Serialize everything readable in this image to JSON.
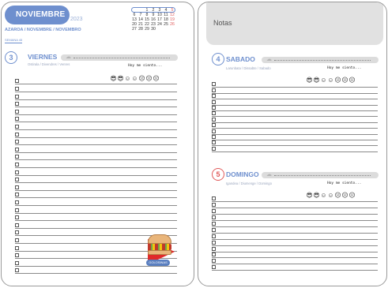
{
  "left": {
    "month": "NOVIEMBRE",
    "year": "2023",
    "subtitle": "AZAROA / NOVEMBRE / NOVEMBRO",
    "week": "SEMANA 45",
    "mini_calendar": [
      [
        "",
        "1",
        "2",
        "3",
        "4",
        "5"
      ],
      [
        "6",
        "7",
        "8",
        "9",
        "10",
        "11",
        "12"
      ],
      [
        "13",
        "14",
        "15",
        "16",
        "17",
        "18",
        "19"
      ],
      [
        "20",
        "21",
        "22",
        "23",
        "24",
        "25",
        "26"
      ],
      [
        "27",
        "28",
        "29",
        "30"
      ]
    ],
    "day": {
      "number": "3",
      "name": "VIERNES",
      "sub": "Ostirala / Divendres / Venres",
      "mood_label": "Hoy me siento...",
      "line_count": 26
    },
    "sticker_label": "GOLOSINAS"
  },
  "right": {
    "notes_title": "Notas",
    "days": [
      {
        "number": "4",
        "name": "SABADO",
        "sub": "Larunbata / Dissabte / Sabado",
        "mood_label": "Hoy me siento...",
        "line_count": 12
      },
      {
        "number": "5",
        "name": "DOMINGO",
        "sub": "Igandea / Diumenge / Domingo",
        "mood_label": "Hoy me siento...",
        "line_count": 12
      }
    ]
  },
  "colors": {
    "accent": "#6e8fce",
    "sunday_red": "#e05a5a",
    "notes_bg": "#e1e1e1"
  },
  "mood_icons": [
    "sunglasses-face-icon",
    "sunglasses-face-icon",
    "laughing-face-icon",
    "smiling-face-icon",
    "surprised-face-icon",
    "sad-face-icon",
    "dizzy-face-icon"
  ]
}
